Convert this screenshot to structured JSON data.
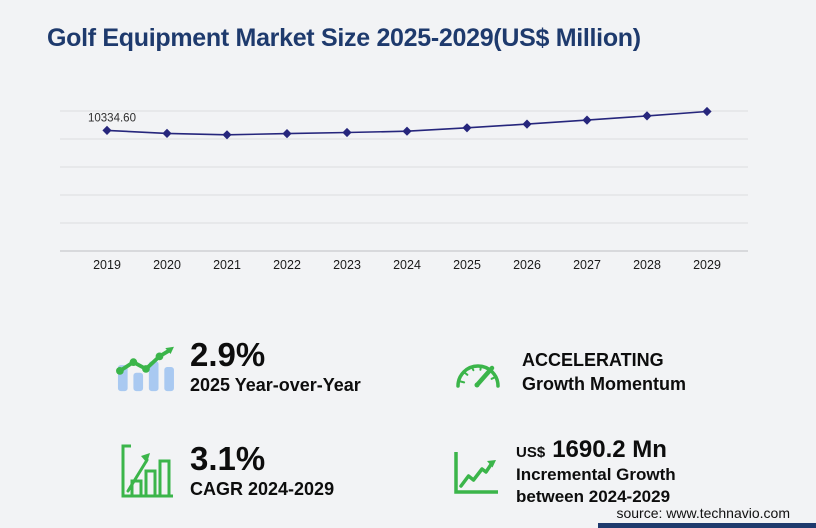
{
  "header": {
    "title": "Golf Equipment Market Size 2025-2029(US$ Million)"
  },
  "chart_data": {
    "type": "line",
    "title": "Golf Equipment Market Size 2025-2029(US$ Million)",
    "x": [
      "2019",
      "2020",
      "2021",
      "2022",
      "2023",
      "2024",
      "2025",
      "2026",
      "2027",
      "2028",
      "2029"
    ],
    "series": [
      {
        "name": "Golf Equipment Market Size (US$ Million)",
        "values": [
          10334.6,
          10080,
          9960,
          10060,
          10160,
          10265.6,
          10563.3,
          10880,
          11220,
          11580,
          11955.8
        ]
      }
    ],
    "point_labels": {
      "2019": "10334.60"
    },
    "ylim": [
      0,
      12000
    ],
    "gridline_count": 6,
    "grid": "horizontal-only",
    "legend": "none",
    "marker": "diamond",
    "line_color": "#26267c"
  },
  "stats": {
    "yoy": {
      "value": "2.9%",
      "label": "2025 Year-over-Year",
      "icon": "bar-line-growth-icon"
    },
    "cagr": {
      "value": "3.1%",
      "label": "CAGR 2024-2029",
      "icon": "outlined-bar-chart-icon"
    },
    "momentum": {
      "line1": "ACCELERATING",
      "line2": "Growth Momentum",
      "icon": "speedometer-icon"
    },
    "incremental": {
      "currency": "US$",
      "value": "1690.2 Mn",
      "line1": "Incremental Growth",
      "line2": "between 2024-2029",
      "icon": "line-chart-axes-icon"
    }
  },
  "footer": {
    "source": "source: www.technavio.com"
  },
  "colors": {
    "title_navy": "#1e3a6d",
    "line_navy": "#26267c",
    "green": "#3bb54a",
    "light_blue": "#a9c9f1",
    "background": "#f2f3f5",
    "gridline": "#dcdce0",
    "axis": "#bfbfc4",
    "accent_bar": "#1e3a6d"
  }
}
